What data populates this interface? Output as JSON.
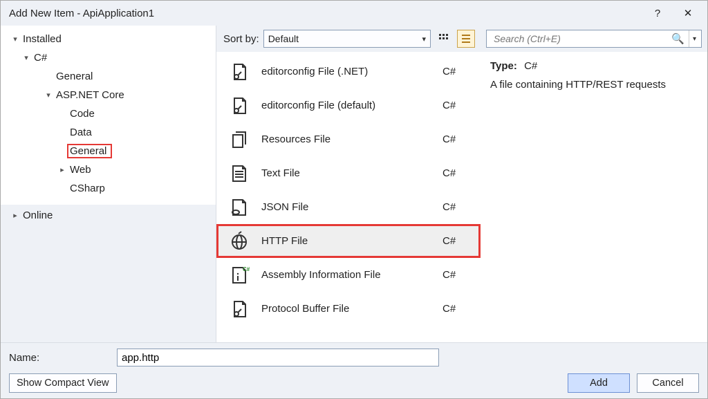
{
  "title": "Add New Item - ApiApplication1",
  "titlebar": {
    "help": "?",
    "close": "✕"
  },
  "tree": {
    "installed": "Installed",
    "csharp": "C#",
    "general": "General",
    "aspnet": "ASP.NET Core",
    "code": "Code",
    "data": "Data",
    "general2": "General",
    "web": "Web",
    "csharp2": "CSharp",
    "online": "Online"
  },
  "toolbar": {
    "sortby": "Sort by:",
    "sort_value": "Default"
  },
  "items": [
    {
      "name": "editorconfig File (.NET)",
      "lang": "C#",
      "icon": "wrench-doc"
    },
    {
      "name": "editorconfig File (default)",
      "lang": "C#",
      "icon": "wrench-doc"
    },
    {
      "name": "Resources File",
      "lang": "C#",
      "icon": "docs"
    },
    {
      "name": "Text File",
      "lang": "C#",
      "icon": "textlines"
    },
    {
      "name": "JSON File",
      "lang": "C#",
      "icon": "json"
    },
    {
      "name": "HTTP File",
      "lang": "C#",
      "icon": "globe",
      "selected": true
    },
    {
      "name": "Assembly Information File",
      "lang": "C#",
      "icon": "info-cs"
    },
    {
      "name": "Protocol Buffer File",
      "lang": "C#",
      "icon": "wrench-doc"
    }
  ],
  "search": {
    "placeholder": "Search (Ctrl+E)"
  },
  "details": {
    "type_label": "Type:",
    "type_value": "C#",
    "description": "A file containing HTTP/REST requests"
  },
  "bottom": {
    "name_label": "Name:",
    "name_value": "app.http",
    "compact": "Show Compact View",
    "add": "Add",
    "cancel": "Cancel"
  }
}
